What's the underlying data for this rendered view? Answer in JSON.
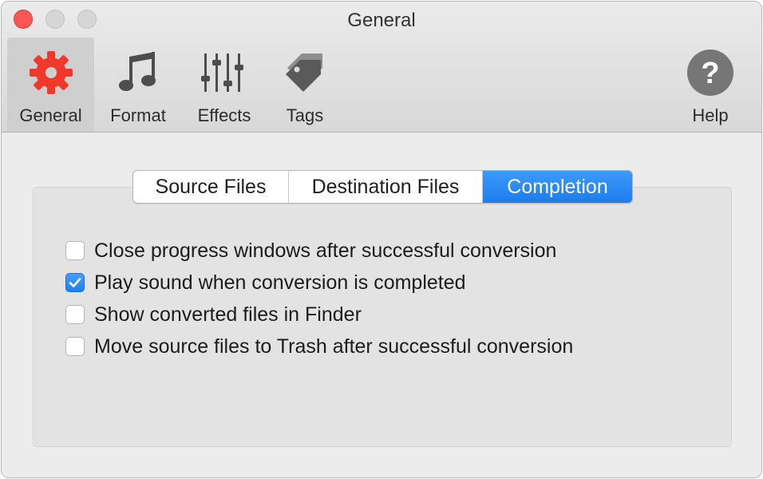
{
  "window": {
    "title": "General"
  },
  "toolbar": {
    "items": [
      {
        "label": "General",
        "icon": "gear-icon",
        "selected": true
      },
      {
        "label": "Format",
        "icon": "music-note-icon",
        "selected": false
      },
      {
        "label": "Effects",
        "icon": "sliders-icon",
        "selected": false
      },
      {
        "label": "Tags",
        "icon": "tag-icon",
        "selected": false
      }
    ],
    "help": {
      "label": "Help",
      "icon": "help-icon",
      "glyph": "?"
    }
  },
  "tabs": [
    {
      "label": "Source Files",
      "active": false
    },
    {
      "label": "Destination Files",
      "active": false
    },
    {
      "label": "Completion",
      "active": true
    }
  ],
  "options": [
    {
      "label": "Close progress windows after successful conversion",
      "checked": false
    },
    {
      "label": "Play sound when conversion is completed",
      "checked": true
    },
    {
      "label": "Show converted files in Finder",
      "checked": false
    },
    {
      "label": "Move source files to Trash after successful conversion",
      "checked": false
    }
  ],
  "colors": {
    "accent": "#1b7df0",
    "gear": "#f0392b",
    "close": "#fc5753"
  }
}
